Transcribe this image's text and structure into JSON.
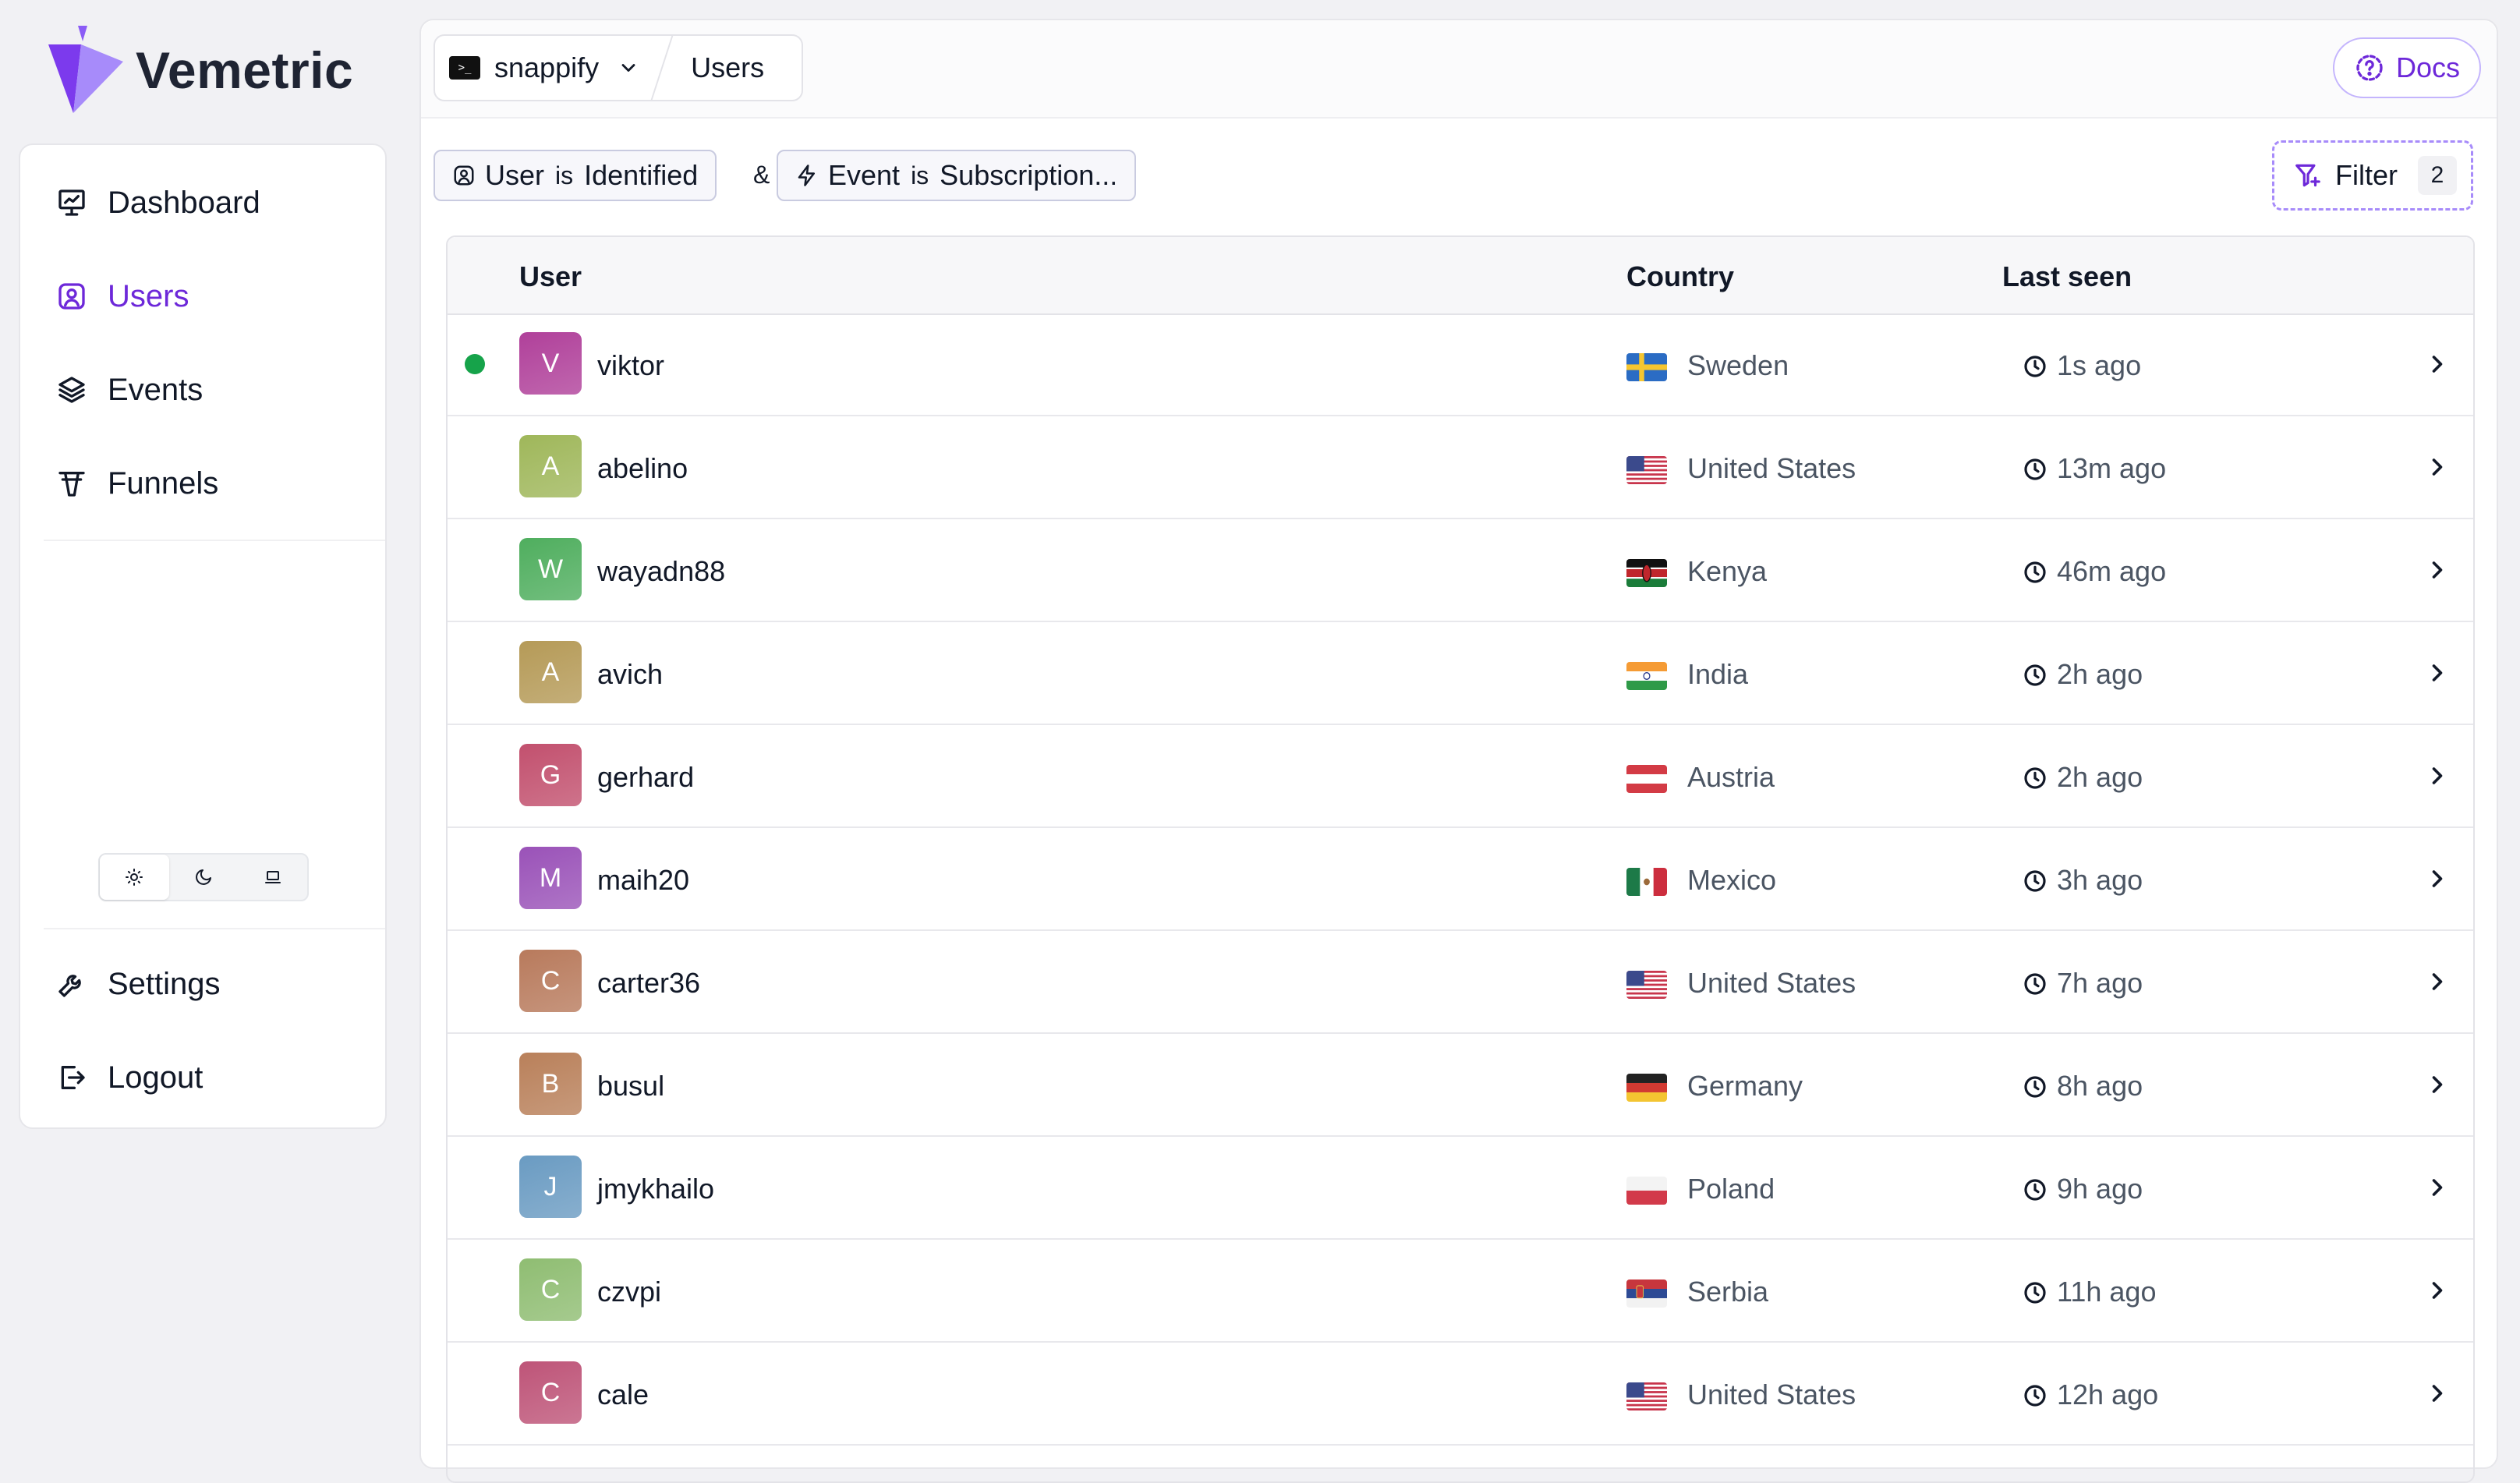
{
  "app": {
    "name": "Vemetric",
    "brand_color": "#6d28d9"
  },
  "sidebar": {
    "nav": [
      {
        "label": "Dashboard",
        "icon": "presentation-chart-icon",
        "active": false
      },
      {
        "label": "Users",
        "icon": "user-circle-icon",
        "active": true
      },
      {
        "label": "Events",
        "icon": "layers-icon",
        "active": false
      },
      {
        "label": "Funnels",
        "icon": "funnel-icon",
        "active": false
      }
    ],
    "theme_options": [
      "light",
      "dark",
      "system"
    ],
    "theme_selected": "light",
    "bottom": [
      {
        "label": "Settings",
        "icon": "wrench-icon"
      },
      {
        "label": "Logout",
        "icon": "logout-icon"
      }
    ]
  },
  "header": {
    "project": "snappify",
    "project_icon": ">_",
    "page": "Users",
    "docs_label": "Docs"
  },
  "filters": {
    "chips": [
      {
        "field": "User",
        "op": "is",
        "value": "Identified",
        "icon": "user-icon"
      },
      {
        "field": "Event",
        "op": "is",
        "value": "Subscription...",
        "icon": "bolt-icon"
      }
    ],
    "joiner": "&",
    "filter_label": "Filter",
    "filter_count": "2"
  },
  "table": {
    "columns": [
      "User",
      "Country",
      "Last seen"
    ],
    "rows": [
      {
        "initial": "V",
        "name": "viktor",
        "country": "Sweden",
        "flag": "se",
        "seen": "1s ago",
        "online": true,
        "color": "#b0409a"
      },
      {
        "initial": "A",
        "name": "abelino",
        "country": "United States",
        "flag": "us",
        "seen": "13m ago",
        "online": false,
        "color": "#9fb75a"
      },
      {
        "initial": "W",
        "name": "wayadn88",
        "country": "Kenya",
        "flag": "ke",
        "seen": "46m ago",
        "online": false,
        "color": "#4fae5e"
      },
      {
        "initial": "A",
        "name": "avich",
        "country": "India",
        "flag": "in",
        "seen": "2h ago",
        "online": false,
        "color": "#b59a57"
      },
      {
        "initial": "G",
        "name": "gerhard",
        "country": "Austria",
        "flag": "at",
        "seen": "2h ago",
        "online": false,
        "color": "#c2506e"
      },
      {
        "initial": "M",
        "name": "maih20",
        "country": "Mexico",
        "flag": "mx",
        "seen": "3h ago",
        "online": false,
        "color": "#9a52b8"
      },
      {
        "initial": "C",
        "name": "carter36",
        "country": "United States",
        "flag": "us",
        "seen": "7h ago",
        "online": false,
        "color": "#b87a5c"
      },
      {
        "initial": "B",
        "name": "busul",
        "country": "Germany",
        "flag": "de",
        "seen": "8h ago",
        "online": false,
        "color": "#b9805a"
      },
      {
        "initial": "J",
        "name": "jmykhailo",
        "country": "Poland",
        "flag": "pl",
        "seen": "9h ago",
        "online": false,
        "color": "#6a9bc2"
      },
      {
        "initial": "C",
        "name": "czvpi",
        "country": "Serbia",
        "flag": "rs",
        "seen": "11h ago",
        "online": false,
        "color": "#8fbd72"
      },
      {
        "initial": "C",
        "name": "cale",
        "country": "United States",
        "flag": "us",
        "seen": "12h ago",
        "online": false,
        "color": "#be5478"
      }
    ]
  }
}
